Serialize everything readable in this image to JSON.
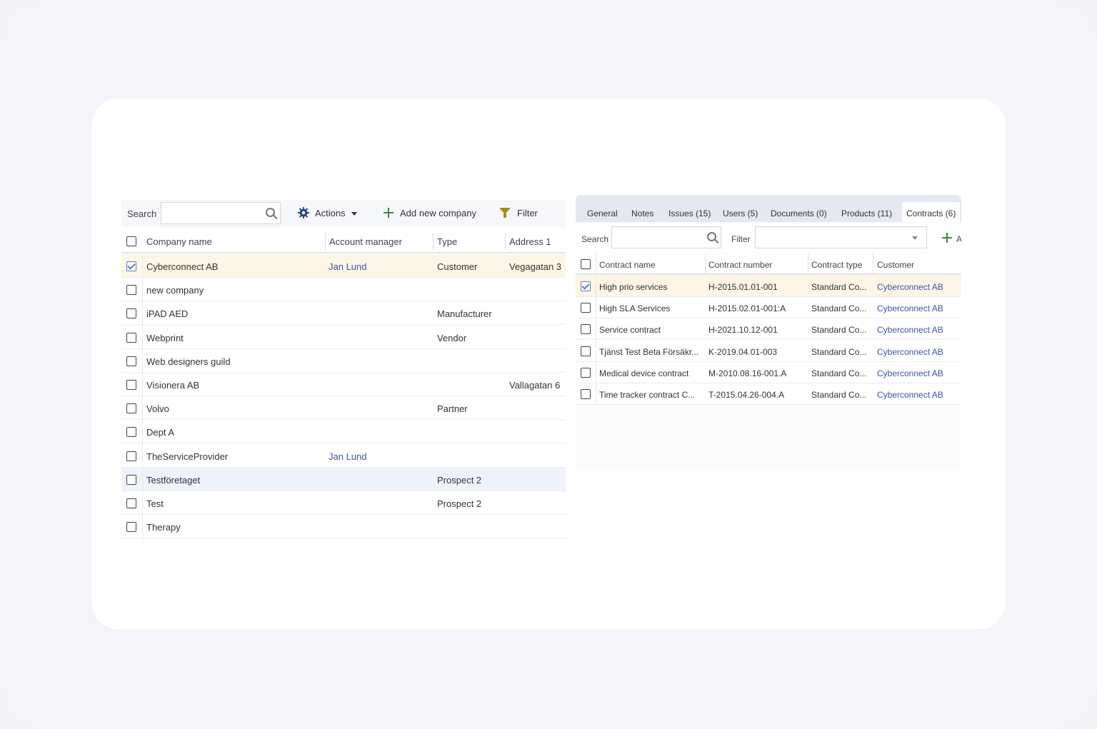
{
  "left": {
    "toolbar": {
      "search_label": "Search",
      "search_value": "",
      "actions_label": "Actions",
      "add_label": "Add new company",
      "filter_label": "Filter"
    },
    "columns": [
      "Company name",
      "Account manager",
      "Type",
      "Address 1"
    ],
    "rows": [
      {
        "name": "Cyberconnect AB",
        "manager": "Jan Lund",
        "type": "Customer",
        "address": "Vegagatan 3",
        "checked": true
      },
      {
        "name": "new company",
        "manager": "",
        "type": "",
        "address": "",
        "checked": false
      },
      {
        "name": "iPAD AED",
        "manager": "",
        "type": "Manufacturer",
        "address": "",
        "checked": false
      },
      {
        "name": "Webprint",
        "manager": "",
        "type": "Vendor",
        "address": "",
        "checked": false
      },
      {
        "name": "Web designers guild",
        "manager": "",
        "type": "",
        "address": "",
        "checked": false
      },
      {
        "name": "Visionera AB",
        "manager": "",
        "type": "",
        "address": "Vallagatan 6",
        "checked": false
      },
      {
        "name": "Volvo",
        "manager": "",
        "type": "Partner",
        "address": "",
        "checked": false
      },
      {
        "name": "Dept A",
        "manager": "",
        "type": "",
        "address": "",
        "checked": false
      },
      {
        "name": "TheServiceProvider",
        "manager": "Jan Lund",
        "type": "",
        "address": "",
        "checked": false
      },
      {
        "name": "Testföretaget",
        "manager": "",
        "type": "Prospect 2",
        "address": "",
        "checked": false
      },
      {
        "name": "Test",
        "manager": "",
        "type": "Prospect 2",
        "address": "",
        "checked": false
      },
      {
        "name": "Therapy",
        "manager": "",
        "type": "",
        "address": "",
        "checked": false
      }
    ]
  },
  "right": {
    "tabs": [
      "General",
      "Notes",
      "Issues (15)",
      "Users (5)",
      "Documents (0)",
      "Products (11)",
      "Contracts (6)"
    ],
    "active_tab": "Contracts (6)",
    "toolbar": {
      "search_label": "Search",
      "filter_label": "Filter",
      "filter_value": "",
      "add_label": "A"
    },
    "columns": [
      "Contract name",
      "Contract number",
      "Contract type",
      "Customer"
    ],
    "rows": [
      {
        "name": "High prio services",
        "number": "H-2015.01.01-001",
        "type": "Standard Co...",
        "customer": "Cyberconnect AB",
        "checked": true
      },
      {
        "name": "High SLA Services",
        "number": "H-2015.02.01-001:A",
        "type": "Standard Co...",
        "customer": "Cyberconnect AB",
        "checked": false
      },
      {
        "name": "Service contract",
        "number": "H-2021.10.12-001",
        "type": "Standard Co...",
        "customer": "Cyberconnect AB",
        "checked": false
      },
      {
        "name": "Tjänst Test Beta Försäkr...",
        "number": "K-2019.04.01-003",
        "type": "Standard Co...",
        "customer": "Cyberconnect AB",
        "checked": false
      },
      {
        "name": "Medical device contract",
        "number": "M-2010.08.16-001.A",
        "type": "Standard Co...",
        "customer": "Cyberconnect AB",
        "checked": false
      },
      {
        "name": "Time tracker contract C...",
        "number": "T-2015.04.26-004.A",
        "type": "Standard Co...",
        "customer": "Cyberconnect AB",
        "checked": false
      }
    ]
  },
  "colors": {
    "link": "#3d55a6",
    "selected_row": "#fdf5e6",
    "hover_row": "#eef3fb",
    "tab_bar": "#e3e8f3",
    "add_icon": "#2e8b3a",
    "filter_icon": "#a48a1a"
  }
}
